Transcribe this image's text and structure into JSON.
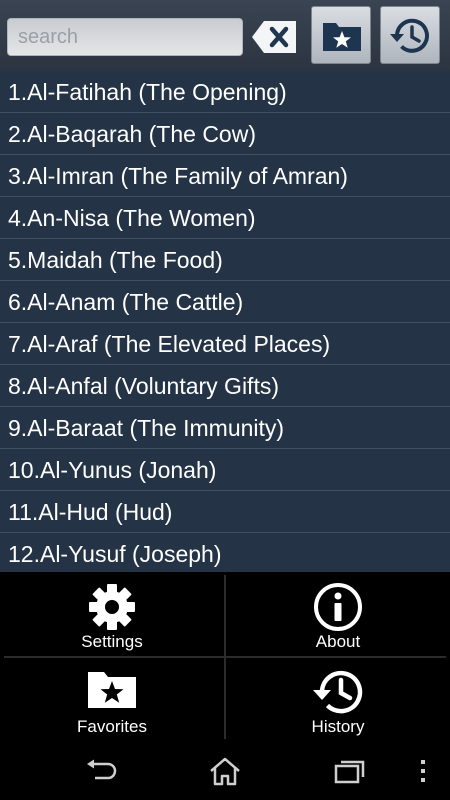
{
  "search": {
    "placeholder": "search",
    "value": ""
  },
  "toolbar": {
    "clear_icon": "backspace-clear-icon",
    "favorites_icon": "folder-star-icon",
    "history_icon": "history-clock-icon"
  },
  "surahs": [
    "1.Al-Fatihah (The Opening)",
    "2.Al-Baqarah (The Cow)",
    "3.Al-Imran (The Family of Amran)",
    "4.An-Nisa (The Women)",
    "5.Maidah (The Food)",
    "6.Al-Anam (The Cattle)",
    "7.Al-Araf (The Elevated Places)",
    "8.Al-Anfal (Voluntary Gifts)",
    "9.Al-Baraat (The Immunity)",
    "10.Al-Yunus (Jonah)",
    "11.Al-Hud (Hud)",
    "12.Al-Yusuf (Joseph)"
  ],
  "menu": {
    "settings": "Settings",
    "about": "About",
    "favorites": "Favorites",
    "history": "History"
  },
  "navbar": {
    "icons": [
      "back-icon",
      "home-icon",
      "recents-icon",
      "overflow-menu-icon"
    ]
  },
  "colors": {
    "list_bg": "#243446",
    "divider": "#3d5064",
    "topbar": "#323b47",
    "menu_bg": "#000000"
  }
}
